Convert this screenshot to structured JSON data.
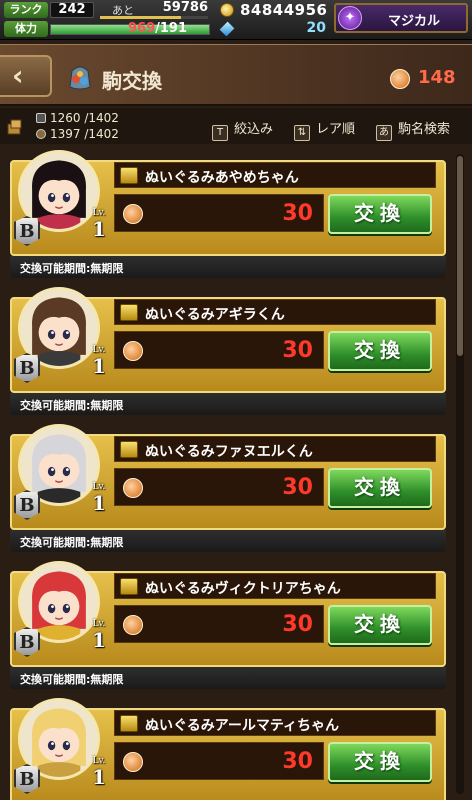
{
  "status": {
    "rank_label": "ランク",
    "rank": "242",
    "ato_label": "あと",
    "ato": "59786",
    "exp_fraction": 0.75,
    "stamina_label": "体力",
    "stamina_current": "969",
    "stamina_max": "/191",
    "stamina_fraction": 1.0,
    "coins": "84844956",
    "gems": "20",
    "magical_label": "マジカル"
  },
  "header": {
    "back_icon": "‹",
    "title": "駒交換",
    "tickets": "148"
  },
  "filter": {
    "count1": "1260 /1402",
    "count2": "1397 /1402",
    "filter_box": "T",
    "filter_label": "絞込み",
    "sort_box": "⇅",
    "sort_label": "レア順",
    "search_box": "あ",
    "search_label": "駒名検索"
  },
  "items": [
    {
      "name": "ぬいぐるみあやめちゃん",
      "rank": "B",
      "lv_label": "Lv.",
      "lv": "1",
      "cost": "30",
      "button": "交換",
      "period": "交換可能期間:無期限",
      "hair": "#1a1014",
      "accent": "#c0304a"
    },
    {
      "name": "ぬいぐるみアギラくん",
      "rank": "B",
      "lv_label": "Lv.",
      "lv": "1",
      "cost": "30",
      "button": "交換",
      "period": "交換可能期間:無期限",
      "hair": "#5a3a24",
      "accent": "#3a3a3a"
    },
    {
      "name": "ぬいぐるみファヌエルくん",
      "rank": "B",
      "lv_label": "Lv.",
      "lv": "1",
      "cost": "30",
      "button": "交換",
      "period": "交換可能期間:無期限",
      "hair": "#d6d6da",
      "accent": "#2a2a2a"
    },
    {
      "name": "ぬいぐるみヴィクトリアちゃん",
      "rank": "B",
      "lv_label": "Lv.",
      "lv": "1",
      "cost": "30",
      "button": "交換",
      "period": "交換可能期間:無期限",
      "hair": "#d8383a",
      "accent": "#e0b030"
    },
    {
      "name": "ぬいぐるみアールマティちゃん",
      "rank": "B",
      "lv_label": "Lv.",
      "lv": "1",
      "cost": "30",
      "button": "交換",
      "period": "",
      "hair": "#f0d070",
      "accent": "#c8a040"
    }
  ]
}
